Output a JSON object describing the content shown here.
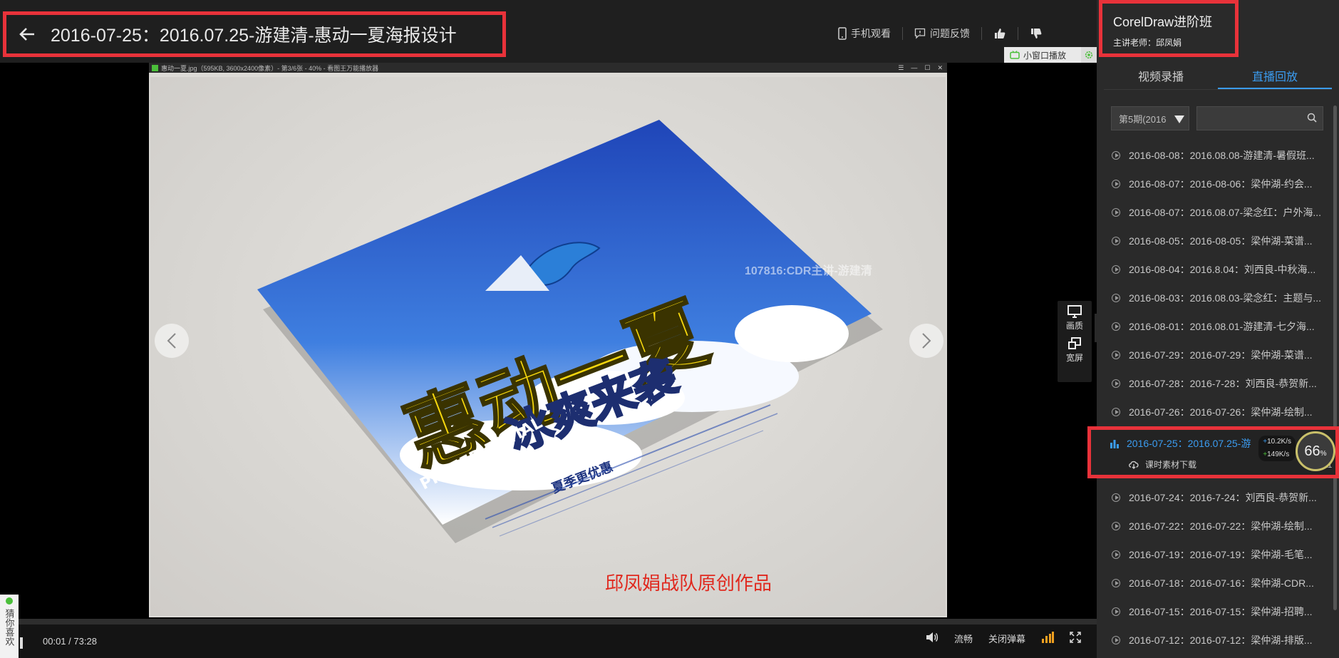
{
  "header": {
    "title": "2016-07-25：2016.07.25-游建清-惠动一夏海报设计",
    "actions": [
      {
        "label": "手机观看",
        "icon": "phone-icon"
      },
      {
        "label": "问题反馈",
        "icon": "feedback-icon"
      }
    ],
    "like_icon": "thumbs-up-icon",
    "dislike_icon": "thumbs-down-icon",
    "mini_window_label": "小窗口播放"
  },
  "slide": {
    "viewer_title": "惠动一夏.jpg（595KB, 3600x2400像素）- 第3/6张 - 40% - 看图王万能播放器",
    "watermark": "107816:CDR主讲-游建清",
    "credit": "邱凤娟战队原创作品",
    "poster_title": "惠动一夏",
    "poster_sub": "冰爽来袭",
    "poster_tag": "夏季更优惠",
    "poster_prefer": "PREFER ENTIAL"
  },
  "side_tools": {
    "quality_label": "画质",
    "widescreen_label": "宽屏"
  },
  "controls": {
    "current_time": "00:01",
    "separator": "/",
    "total_time": "73:28",
    "progress_fraction": 0.0002,
    "fluency_label": "流畅",
    "danmaku_label": "关闭弹幕"
  },
  "guess": {
    "label": "猜你喜欢"
  },
  "panel": {
    "course_title": "CorelDraw进阶班",
    "teacher": "主讲老师：邱凤娟",
    "tabs": [
      {
        "label": "视频录播",
        "active": false
      },
      {
        "label": "直播回放",
        "active": true
      }
    ],
    "period_select": "第5期(2016",
    "search_placeholder": "",
    "items_before": [
      "2016-08-08：2016.08.08-游建清-暑假班...",
      "2016-08-07：2016-08-06：梁仲湖-约会...",
      "2016-08-07：2016.08.07-梁念红：户外海...",
      "2016-08-05：2016-08-05：梁仲湖-菜谱...",
      "2016-08-04：2016.8.04：刘西良-中秋海...",
      "2016-08-03：2016.08.03-梁念红：主题与...",
      "2016-08-01：2016.08.01-游建清-七夕海...",
      "2016-07-29：2016-07-29：梁仲湖-菜谱...",
      "2016-07-28：2016-7-28：刘西良-恭贺新...",
      "2016-07-26：2016-07-26：梁仲湖-绘制..."
    ],
    "active_item": {
      "label": "2016-07-25：2016.07.25-游",
      "download_label": "课时素材下载",
      "upload_speed": "10.2",
      "download_speed": "149",
      "speed_unit": "K/s",
      "size_text": "11",
      "gauge_value": "66",
      "gauge_unit": "%"
    },
    "items_after": [
      "2016-07-24：2016-7-24：刘西良-恭贺新...",
      "2016-07-22：2016-07-22：梁仲湖-绘制...",
      "2016-07-19：2016-07-19：梁仲湖-毛笔...",
      "2016-07-18：2016-07-16：梁仲湖-CDR...",
      "2016-07-15：2016-07-15：梁仲湖-招聘...",
      "2016-07-12：2016-07-12：梁仲湖-排版..."
    ]
  },
  "colors": {
    "accent": "#3b9cf0",
    "highlight_border": "#e8323a",
    "credit_text": "#e0281e"
  }
}
